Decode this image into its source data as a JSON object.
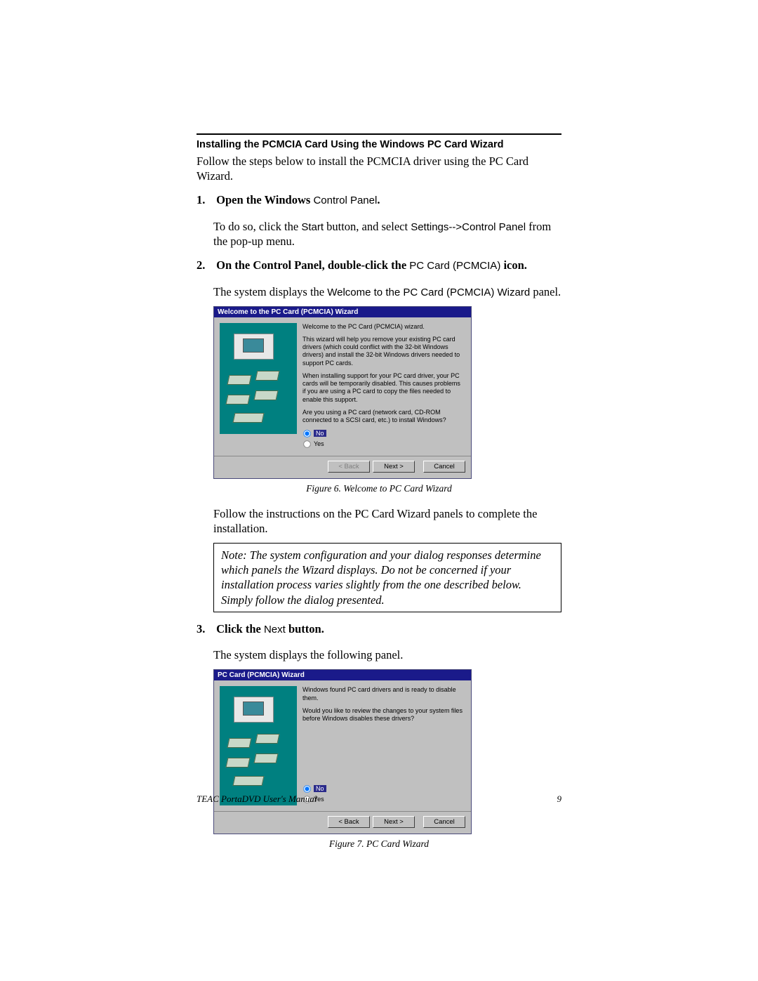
{
  "section_title": "Installing the PCMCIA Card Using the Windows PC Card Wizard",
  "intro": "Follow the steps below to install the PCMCIA driver using the PC Card Wizard.",
  "steps": [
    {
      "num": "1.",
      "head_bold_a": "Open the Windows ",
      "head_sans": "Control Panel",
      "head_bold_b": ".",
      "body_a": "To do so, click the ",
      "body_sans_a": "Start",
      "body_b": " button, and select ",
      "body_sans_b": "Settings-->Control Panel",
      "body_c": " from the pop-up menu."
    },
    {
      "num": "2.",
      "head_bold_a": "On the Control Panel, double-click the ",
      "head_sans": "PC Card (PCMCIA)",
      "head_bold_b": " icon.",
      "body_a": "The system displays the ",
      "body_sans_a": "Welcome to the PC Card (PCMCIA) Wizard",
      "body_b": " panel.",
      "post_fig_text": "Follow the instructions on the PC Card Wizard panels to complete the installation.",
      "note": "Note: The system configuration and your dialog responses determine which panels the Wizard displays. Do not be concerned if your installation process varies slightly from the one described below. Simply follow the dialog presented."
    },
    {
      "num": "3.",
      "head_bold_a": "Click the ",
      "head_sans": "Next",
      "head_bold_b": " button.",
      "body_plain": "The system displays the following panel."
    }
  ],
  "fig6": {
    "caption": "Figure 6. Welcome to PC Card Wizard",
    "title": "Welcome to the PC Card (PCMCIA) Wizard",
    "p1": "Welcome to the PC Card (PCMCIA) wizard.",
    "p2": "This wizard will help you remove your existing PC card drivers (which could conflict with the 32-bit Windows drivers) and install the 32-bit Windows drivers needed to support PC cards.",
    "p3": "When installing support for your PC card driver, your PC cards will be temporarily disabled. This causes problems if you are using a PC card to copy the files needed to enable this support.",
    "p4": "Are you using a PC card (network card, CD-ROM connected to a SCSI card, etc.) to install Windows?",
    "opt_no": "No",
    "opt_yes": "Yes",
    "btn_back": "< Back",
    "btn_next": "Next >",
    "btn_cancel": "Cancel"
  },
  "fig7": {
    "caption": "Figure 7. PC Card Wizard",
    "title": "PC Card (PCMCIA) Wizard",
    "p1": "Windows found PC card drivers and is ready to disable them.",
    "p2": "Would you like to review the changes to your system files before Windows disables these drivers?",
    "opt_no": "No",
    "opt_yes": "Yes",
    "btn_back": "< Back",
    "btn_next": "Next >",
    "btn_cancel": "Cancel"
  },
  "footer_left": "TEAC PortaDVD User's Manual",
  "footer_right": "9"
}
